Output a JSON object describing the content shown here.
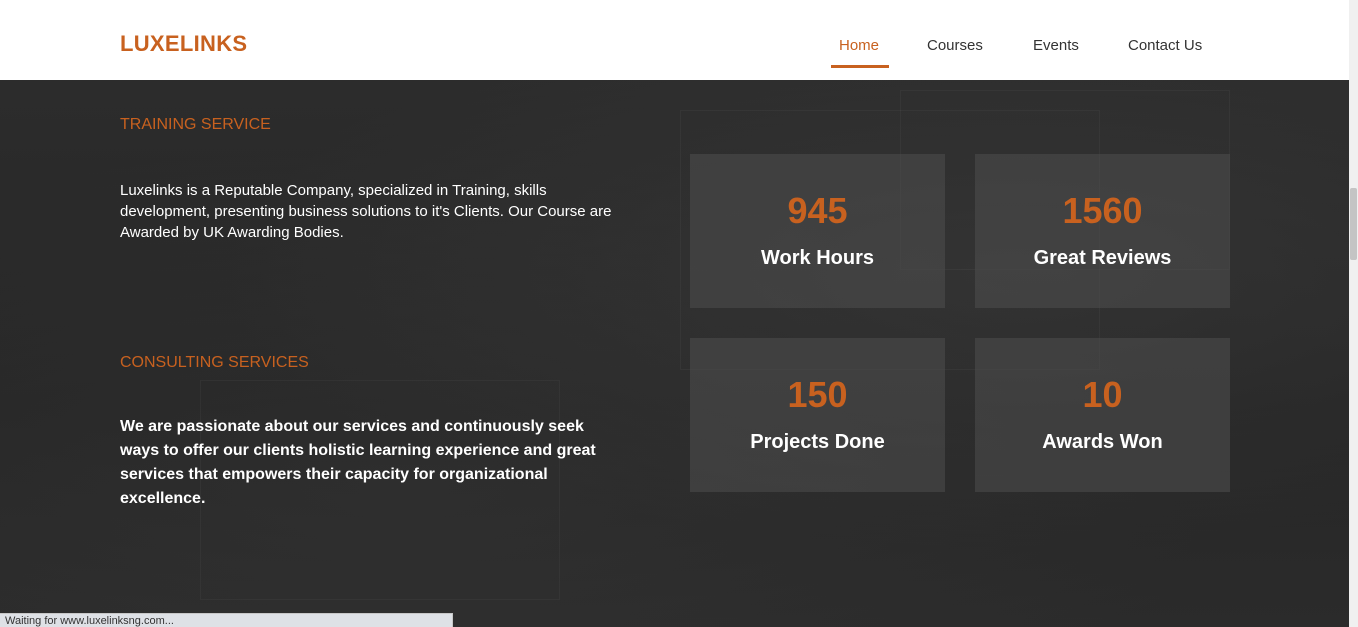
{
  "brand": "LUXELINKS",
  "nav": {
    "home": "Home",
    "courses": "Courses",
    "events": "Events",
    "contact": "Contact Us"
  },
  "training": {
    "title": "TRAINING SERVICE",
    "text": "Luxelinks is a Reputable Company, specialized in Training, skills development, presenting business solutions to it's Clients. Our Course are Awarded by UK Awarding Bodies."
  },
  "consulting": {
    "title": "CONSULTING SERVICES",
    "text": "We are passionate about our services and continuously seek ways to offer our clients holistic learning experience and great services that empowers their capacity for organizational excellence."
  },
  "stats": [
    {
      "value": "945",
      "label": "Work Hours"
    },
    {
      "value": "1560",
      "label": "Great Reviews"
    },
    {
      "value": "150",
      "label": "Projects Done"
    },
    {
      "value": "10",
      "label": "Awards Won"
    }
  ],
  "status_bar": "Waiting for www.luxelinksng.com...",
  "colors": {
    "accent": "#c8611f",
    "background": "#2a2a2a",
    "card": "#4e4e4e"
  }
}
